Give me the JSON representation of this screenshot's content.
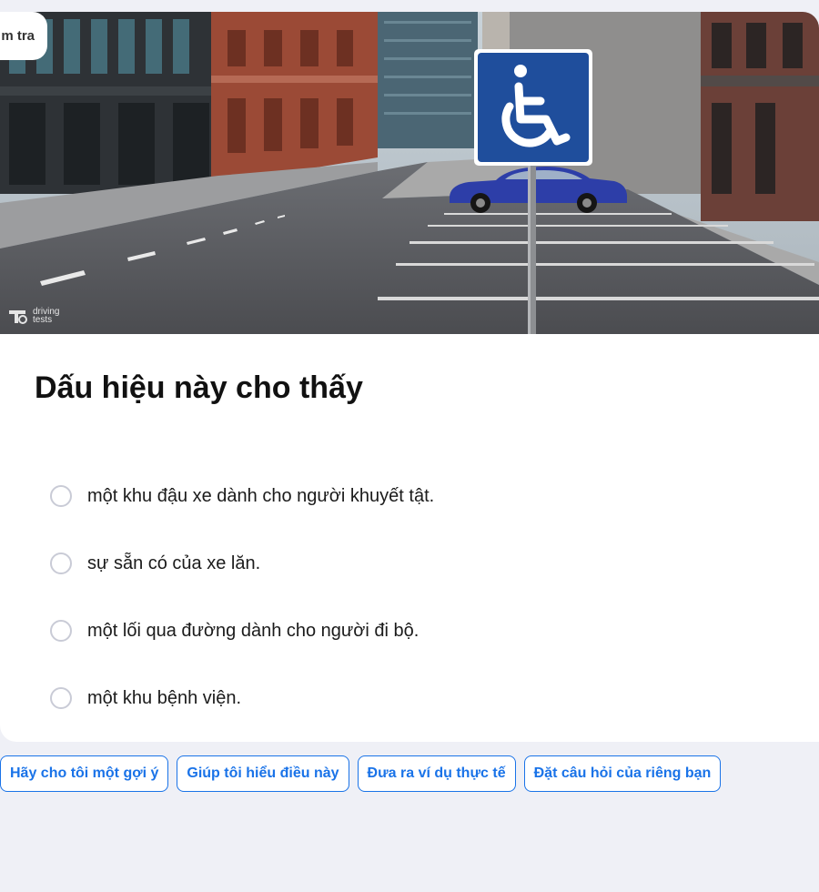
{
  "header": {
    "tag_label": "m tra"
  },
  "image": {
    "watermark": "driving tests",
    "icon": "wheelchair-accessible-sign-icon",
    "colors": {
      "sign_blue": "#1f4e9c",
      "car_blue": "#2d3ea8"
    }
  },
  "question": {
    "title": "Dấu hiệu này cho thấy",
    "options": [
      {
        "label": "một khu đậu xe dành cho người khuyết tật."
      },
      {
        "label": "sự sẵn có của xe lăn."
      },
      {
        "label": "một lối qua đường dành cho người đi bộ."
      },
      {
        "label": "một khu bệnh viện."
      }
    ]
  },
  "suggestions": [
    {
      "label": "Hãy cho tôi một gợi ý"
    },
    {
      "label": "Giúp tôi hiểu điều này"
    },
    {
      "label": "Đưa ra ví dụ thực tế"
    },
    {
      "label": "Đặt câu hỏi của riêng bạn"
    }
  ],
  "colors": {
    "accent": "#1a73e8",
    "background": "#eff0f6",
    "card": "#ffffff"
  }
}
